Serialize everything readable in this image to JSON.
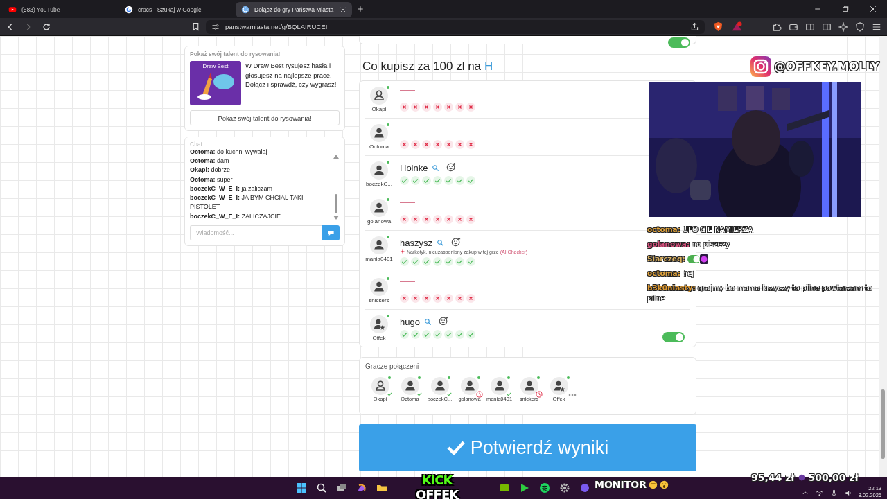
{
  "browser": {
    "tabs": [
      {
        "title": "(583) YouTube",
        "kind": "youtube",
        "selected": false
      },
      {
        "title": "crocs - Szukaj w Google",
        "kind": "google",
        "selected": false
      },
      {
        "title": "Dołącz do gry Państwa Miasta",
        "kind": "site",
        "selected": true
      }
    ],
    "address": "panstwamiasta.net/g/BQLAIRUCEI"
  },
  "promo": {
    "title": "Pokaż swój talent do rysowania!",
    "image_title": "Draw Best",
    "text": "W Draw Best rysujesz hasła i głosujesz na najlepsze prace. Dołącz i sprawdź, czy wygrasz!",
    "button": "Pokaż swój talent do rysowania!"
  },
  "chat": {
    "title": "Chat",
    "messages": [
      {
        "author": "Octoma:",
        "text": "do kuchni wywalaj"
      },
      {
        "author": "Octoma:",
        "text": "dam"
      },
      {
        "author": "Okapi:",
        "text": "dobrze"
      },
      {
        "author": "Octoma:",
        "text": "super"
      },
      {
        "author": "boczekC_W_E_I:",
        "text": "ja zaliczam"
      },
      {
        "author": "boczekC_W_E_I:",
        "text": "JA BYM CHCIAL TAKI PISTOLET"
      },
      {
        "author": "boczekC_W_E_I:",
        "text": "ZALICZAJCIE"
      }
    ],
    "placeholder": "Wiadomość..."
  },
  "top_card": {
    "toggle_on": true
  },
  "question": {
    "text": "Co kupisz za 100 zl na",
    "letter": "H"
  },
  "answers": [
    {
      "player": "Okapi",
      "kind": "outline",
      "online": true,
      "votes": [
        {
          "accepted": false
        },
        {
          "accepted": false
        },
        {
          "accepted": false
        },
        {
          "accepted": false
        },
        {
          "accepted": false
        },
        {
          "accepted": false
        },
        {
          "accepted": false
        }
      ]
    },
    {
      "player": "Octoma",
      "kind": "filled",
      "online": true,
      "votes": [
        {
          "accepted": false
        },
        {
          "accepted": false
        },
        {
          "accepted": false
        },
        {
          "accepted": false
        },
        {
          "accepted": false
        },
        {
          "accepted": false
        },
        {
          "accepted": false
        }
      ]
    },
    {
      "player": "boczekC...",
      "kind": "filled",
      "online": true,
      "answer": "Hoinke",
      "votes": [
        {
          "accepted": true
        },
        {
          "accepted": true
        },
        {
          "accepted": true
        },
        {
          "accepted": true
        },
        {
          "accepted": true
        },
        {
          "accepted": true
        },
        {
          "accepted": true
        }
      ]
    },
    {
      "player": "golanowa",
      "kind": "filled",
      "online": true,
      "votes": [
        {
          "accepted": false
        },
        {
          "accepted": false
        },
        {
          "accepted": false
        },
        {
          "accepted": false
        },
        {
          "accepted": false
        },
        {
          "accepted": false
        },
        {
          "accepted": false
        }
      ]
    },
    {
      "player": "mania0401",
      "kind": "filled",
      "online": true,
      "answer": "haszysz",
      "ai_note": "Narkotyk, nieuzasadniony zakup w tej grze",
      "ai_source": "(AI Checker)",
      "votes": [
        {
          "accepted": true
        },
        {
          "accepted": true
        },
        {
          "accepted": true
        },
        {
          "accepted": true
        },
        {
          "accepted": true
        },
        {
          "accepted": true
        },
        {
          "accepted": true
        }
      ]
    },
    {
      "player": "snickers",
      "kind": "filled",
      "online": true,
      "votes": [
        {
          "accepted": false
        },
        {
          "accepted": false
        },
        {
          "accepted": false
        },
        {
          "accepted": false
        },
        {
          "accepted": false
        },
        {
          "accepted": false
        },
        {
          "accepted": false
        }
      ]
    },
    {
      "player": "Offek",
      "kind": "star",
      "online": true,
      "answer": "hugo",
      "toggle_on": true,
      "votes": [
        {
          "accepted": true
        },
        {
          "accepted": true
        },
        {
          "accepted": true
        },
        {
          "accepted": true
        },
        {
          "accepted": true
        },
        {
          "accepted": true
        },
        {
          "accepted": true
        }
      ]
    }
  ],
  "connected": {
    "title": "Gracze połączeni",
    "players": [
      {
        "name": "Okapi",
        "kind": "outline",
        "submitted": true,
        "typing": false
      },
      {
        "name": "Octoma",
        "kind": "filled",
        "submitted": true,
        "typing": false
      },
      {
        "name": "boczekC...",
        "kind": "filled",
        "submitted": true,
        "typing": false
      },
      {
        "name": "golanowa",
        "kind": "filled",
        "submitted": false,
        "typing": false
      },
      {
        "name": "mania0401",
        "kind": "filled",
        "submitted": true,
        "typing": false
      },
      {
        "name": "snickers",
        "kind": "filled",
        "submitted": false,
        "typing": false
      },
      {
        "name": "Offek",
        "kind": "star",
        "submitted": false,
        "typing": true
      }
    ]
  },
  "confirm_button": "Potwierdź wyniki",
  "stream": {
    "instagram": "@OFFKEY.MOLLY",
    "chat": [
      {
        "user": "octoma:",
        "text": "UFO CIE NAMIERZA",
        "color": "#e0a23a"
      },
      {
        "user": "golanowa:",
        "text": "no piszczy",
        "color": "#d9507e"
      },
      {
        "user": "Siarczeq:",
        "kind": "emote",
        "color": "#d9b060"
      },
      {
        "user": "octoma:",
        "text": "hej",
        "color": "#e0a23a"
      },
      {
        "user": "b3k0niasty:",
        "text": "grajmy bo mama krzyczy to pilne powtarzam to pilne",
        "color": "#e09a30"
      }
    ],
    "logo_top": "KICK",
    "logo_bottom": "OFFEK",
    "monitor": "MONITOR",
    "goal_current": "95,44 zł",
    "goal_target": "500,00 zł"
  },
  "taskbar": {
    "time": "22:13",
    "date": "8.02.2026"
  }
}
